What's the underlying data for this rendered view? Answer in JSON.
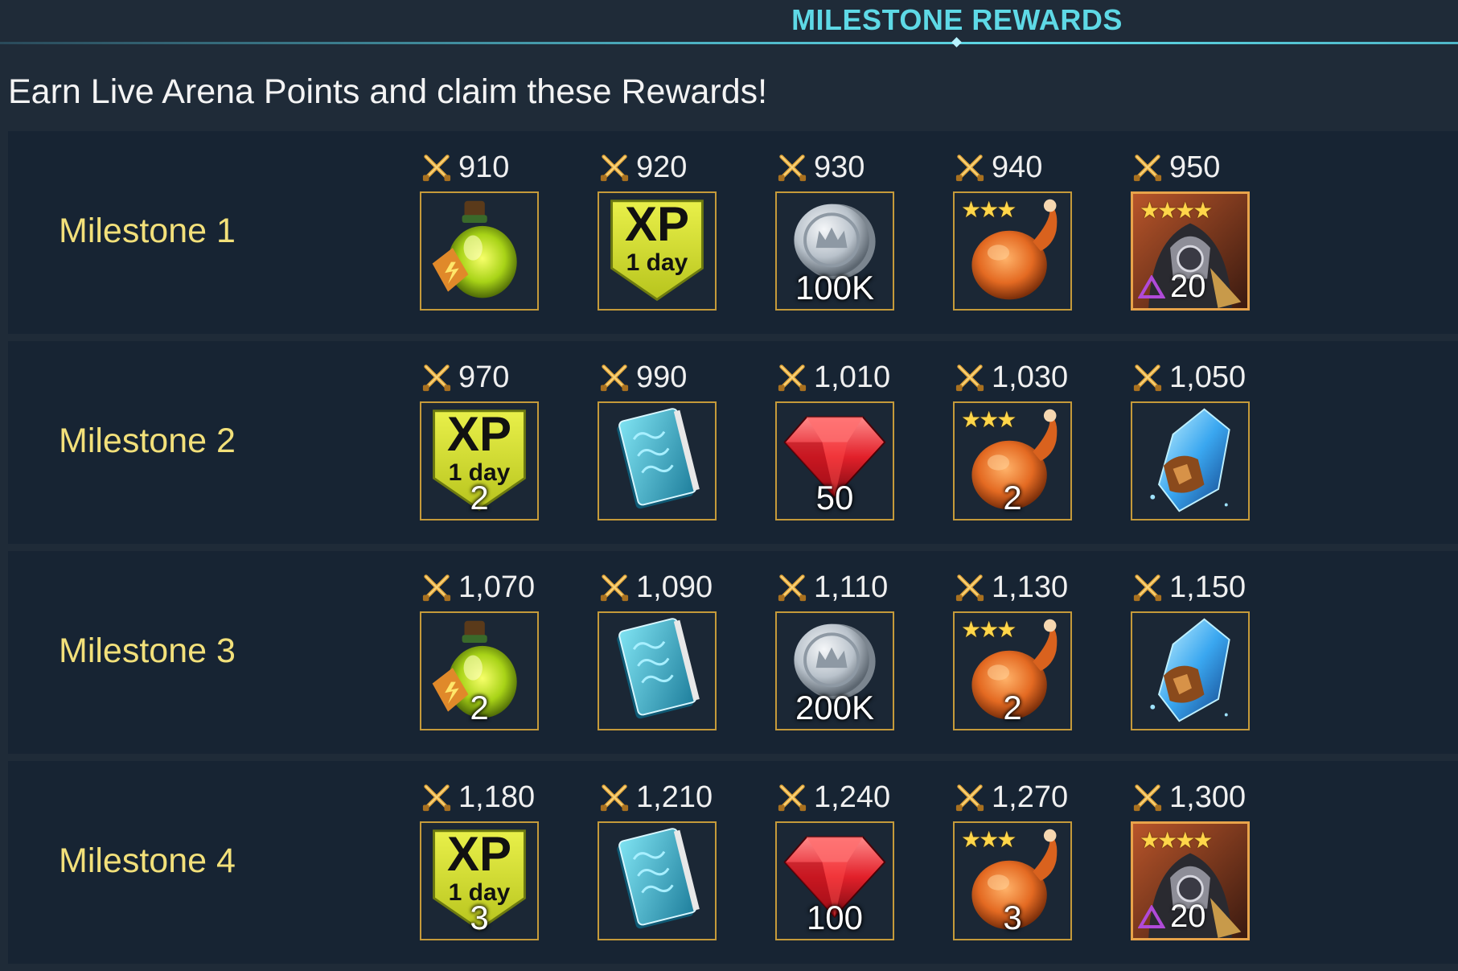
{
  "header": {
    "title": "MILESTONE REWARDS"
  },
  "subtitle": "Earn Live Arena Points and claim these Rewards!",
  "colors": {
    "accent": "#5ed9e6",
    "milestone_label": "#f2e07a",
    "tile_border": "#c59a3a"
  },
  "milestones": [
    {
      "label": "Milestone 1",
      "rewards": [
        {
          "points": "910",
          "icon": "energy-potion-icon",
          "qty": ""
        },
        {
          "points": "920",
          "icon": "xp-boost-icon",
          "xp": "XP",
          "xp_sub": "1 day",
          "qty": ""
        },
        {
          "points": "930",
          "icon": "silver-coin-icon",
          "qty": "100K"
        },
        {
          "points": "940",
          "icon": "chicken-food-icon",
          "stars": "★★★",
          "qty": ""
        },
        {
          "points": "950",
          "icon": "champion-portrait-icon",
          "stars": "★★★★",
          "ascend": "20"
        }
      ]
    },
    {
      "label": "Milestone 2",
      "rewards": [
        {
          "points": "970",
          "icon": "xp-boost-icon",
          "xp": "XP",
          "xp_sub": "1 day",
          "qty": "2"
        },
        {
          "points": "990",
          "icon": "skill-tome-icon",
          "qty": ""
        },
        {
          "points": "1,010",
          "icon": "ruby-gem-icon",
          "qty": "50"
        },
        {
          "points": "1,030",
          "icon": "chicken-food-icon",
          "stars": "★★★",
          "qty": "2"
        },
        {
          "points": "1,050",
          "icon": "mystery-shard-icon",
          "qty": ""
        }
      ]
    },
    {
      "label": "Milestone 3",
      "rewards": [
        {
          "points": "1,070",
          "icon": "energy-potion-icon",
          "qty": "2"
        },
        {
          "points": "1,090",
          "icon": "skill-tome-icon",
          "qty": ""
        },
        {
          "points": "1,110",
          "icon": "silver-coin-icon",
          "qty": "200K"
        },
        {
          "points": "1,130",
          "icon": "chicken-food-icon",
          "stars": "★★★",
          "qty": "2"
        },
        {
          "points": "1,150",
          "icon": "mystery-shard-icon",
          "qty": ""
        }
      ]
    },
    {
      "label": "Milestone 4",
      "rewards": [
        {
          "points": "1,180",
          "icon": "xp-boost-icon",
          "xp": "XP",
          "xp_sub": "1 day",
          "qty": "3"
        },
        {
          "points": "1,210",
          "icon": "skill-tome-icon",
          "qty": ""
        },
        {
          "points": "1,240",
          "icon": "ruby-gem-icon",
          "qty": "100"
        },
        {
          "points": "1,270",
          "icon": "chicken-food-icon",
          "stars": "★★★",
          "qty": "3"
        },
        {
          "points": "1,300",
          "icon": "champion-portrait-icon",
          "stars": "★★★★",
          "ascend": "20"
        }
      ]
    }
  ]
}
